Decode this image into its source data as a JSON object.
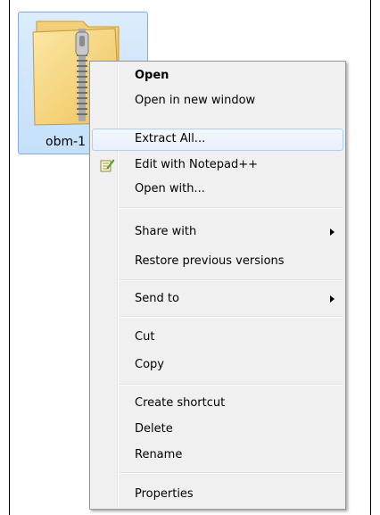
{
  "file": {
    "label": "obm-1",
    "icon": "zip-folder-icon"
  },
  "context_menu": {
    "items": [
      {
        "id": "open",
        "label": "Open"
      },
      {
        "id": "open_new_window",
        "label": "Open in new window"
      },
      {
        "id": "extract_all",
        "label": "Extract All..."
      },
      {
        "id": "edit_notepadpp",
        "label": "Edit with Notepad++",
        "icon": "notepad-plus-plus-icon"
      },
      {
        "id": "open_with",
        "label": "Open with..."
      },
      {
        "id": "share_with",
        "label": "Share with"
      },
      {
        "id": "restore_previous",
        "label": "Restore previous versions"
      },
      {
        "id": "send_to",
        "label": "Send to"
      },
      {
        "id": "cut",
        "label": "Cut"
      },
      {
        "id": "copy",
        "label": "Copy"
      },
      {
        "id": "create_shortcut",
        "label": "Create shortcut"
      },
      {
        "id": "delete",
        "label": "Delete"
      },
      {
        "id": "rename",
        "label": "Rename"
      },
      {
        "id": "properties",
        "label": "Properties"
      }
    ]
  },
  "colors": {
    "selection_fill": "#c4e0fb",
    "selection_border": "#84acdd",
    "menu_background": "#f0f0f0",
    "menu_highlight_border": "#aecff7"
  }
}
